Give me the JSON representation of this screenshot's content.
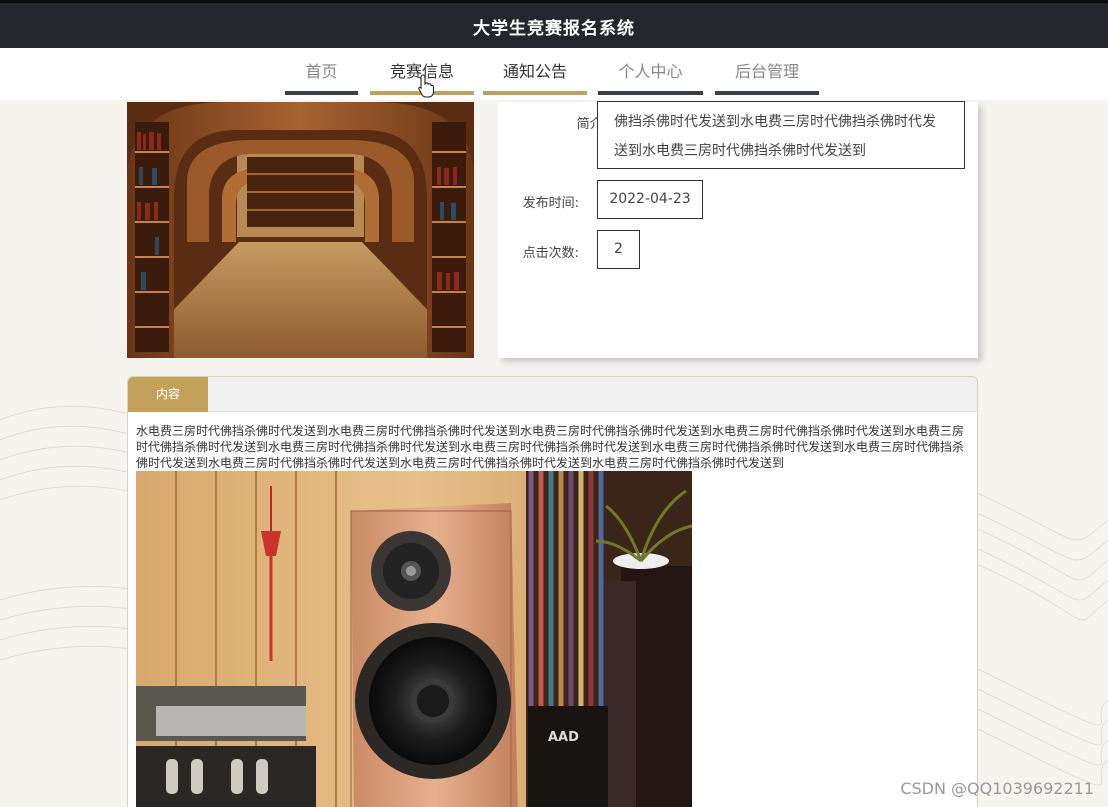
{
  "header": {
    "title": "大学生竞赛报名系统"
  },
  "nav": {
    "items": [
      {
        "label": "首页",
        "active": false
      },
      {
        "label": "竞赛信息",
        "active": true
      },
      {
        "label": "通知公告",
        "active": true
      },
      {
        "label": "个人中心",
        "active": false
      },
      {
        "label": "后台管理",
        "active": false
      }
    ]
  },
  "detail": {
    "intro_label": "简介:",
    "intro_text": "佛挡杀佛时代发送到水电费三房时代佛挡杀佛时代发送到水电费三房时代佛挡杀佛时代发送到",
    "publish_label": "发布时间:",
    "publish_value": "2022-04-23",
    "clicks_label": "点击次数:",
    "clicks_value": "2"
  },
  "content": {
    "tab_label": "内容",
    "text": "水电费三房时代佛挡杀佛时代发送到水电费三房时代佛挡杀佛时代发送到水电费三房时代佛挡杀佛时代发送到水电费三房时代佛挡杀佛时代发送到水电费三房时代佛挡杀佛时代发送到水电费三房时代佛挡杀佛时代发送到水电费三房时代佛挡杀佛时代发送到水电费三房时代佛挡杀佛时代发送到水电费三房时代佛挡杀佛时代发送到水电费三房时代佛挡杀佛时代发送到水电费三房时代佛挡杀佛时代发送到水电费三房时代佛挡杀佛时代发送到"
  },
  "speaker_brand": "AAD",
  "colors": {
    "accent": "#c2a15a",
    "header": "#23272d",
    "nav_bar": "#3b3e44"
  },
  "watermark": "CSDN @QQ1039692211"
}
